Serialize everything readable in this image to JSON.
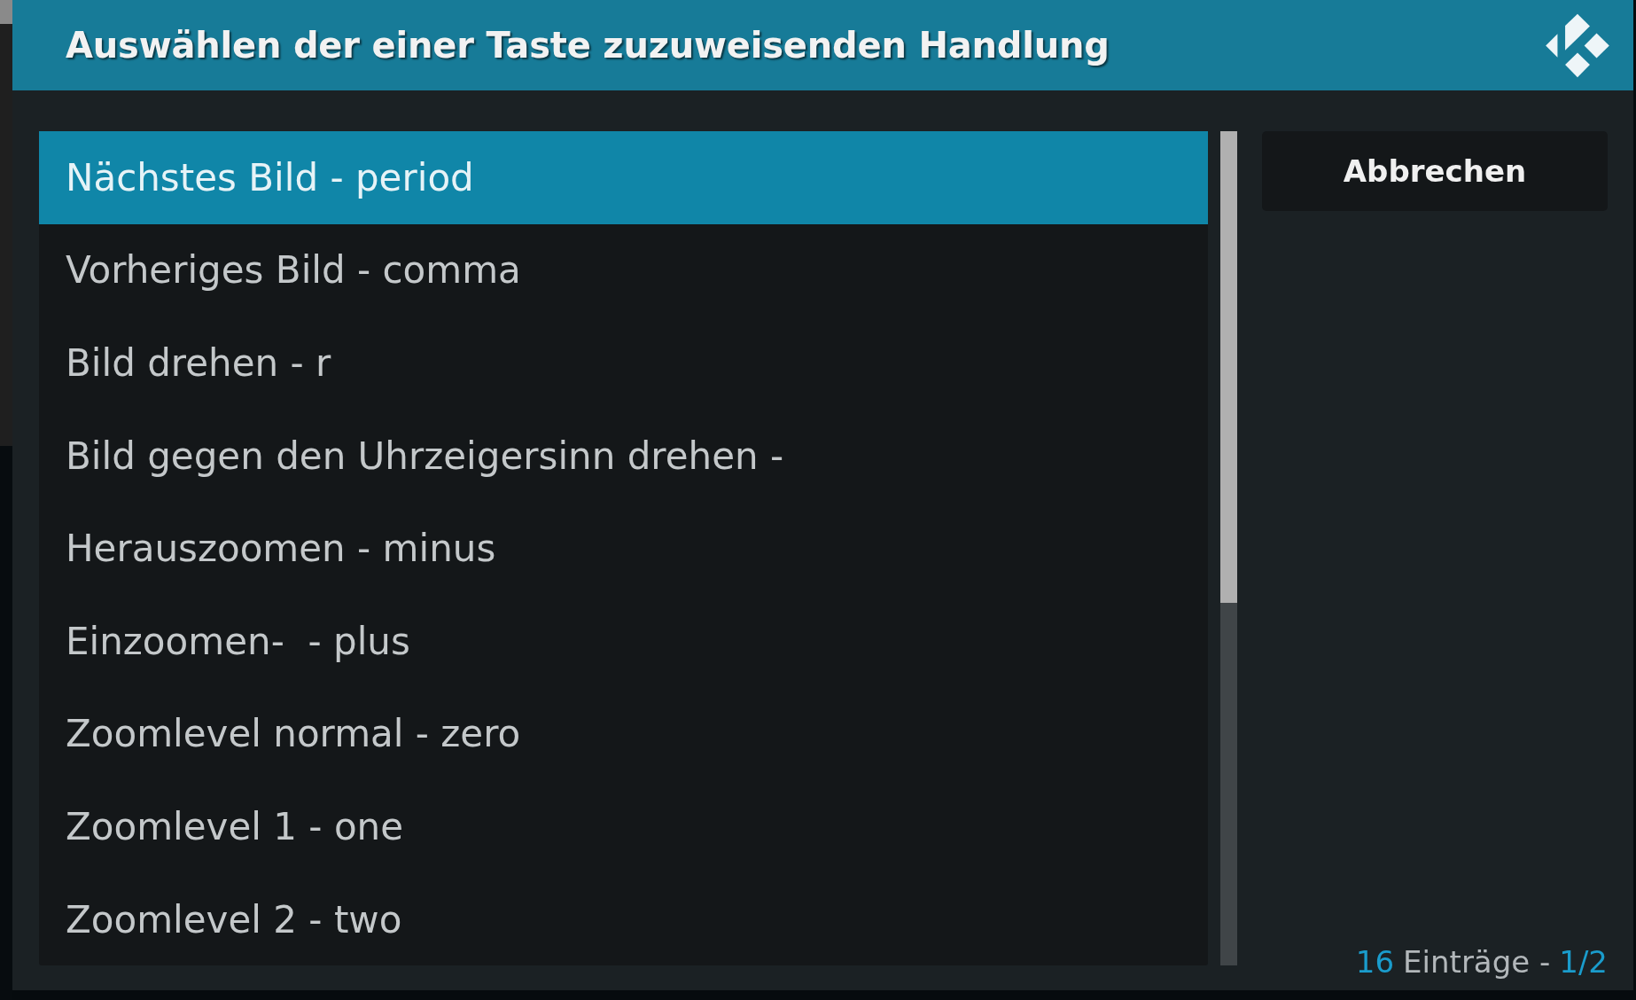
{
  "dialog": {
    "title": "Auswählen der einer Taste zuzuweisenden Handlung"
  },
  "actions": {
    "items": [
      {
        "label": "Nächstes Bild - period",
        "selected": true
      },
      {
        "label": "Vorheriges Bild - comma",
        "selected": false
      },
      {
        "label": "Bild drehen - r",
        "selected": false
      },
      {
        "label": "Bild gegen den Uhrzeigersinn drehen -",
        "selected": false
      },
      {
        "label": "Herauszoomen - minus",
        "selected": false
      },
      {
        "label": "Einzoomen-  - plus",
        "selected": false
      },
      {
        "label": "Zoomlevel normal - zero",
        "selected": false
      },
      {
        "label": "Zoomlevel 1 - one",
        "selected": false
      },
      {
        "label": "Zoomlevel 2 - two",
        "selected": false
      }
    ]
  },
  "cancel_button": {
    "label": "Abbrechen"
  },
  "footer": {
    "count": "16",
    "label": "Einträge -",
    "page": "1/2"
  }
}
